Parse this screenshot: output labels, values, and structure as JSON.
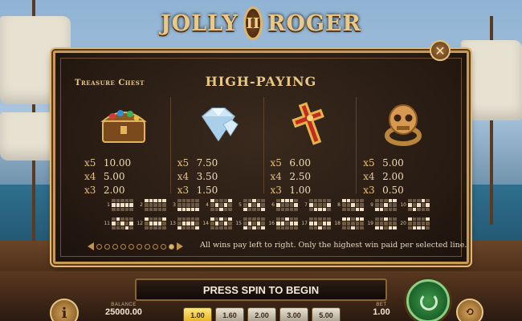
{
  "logo": {
    "left": "JOLLY",
    "emblem": "II",
    "right": "ROGER"
  },
  "panel": {
    "corner_label": "Treasure Chest",
    "title": "HIGH-PAYING",
    "close_icon": "✕",
    "symbols": [
      {
        "icon": "treasure-chest-icon",
        "payouts": [
          [
            "x5",
            "10.00"
          ],
          [
            "x4",
            "5.00"
          ],
          [
            "x3",
            "2.00"
          ]
        ]
      },
      {
        "icon": "diamond-icon",
        "payouts": [
          [
            "x5",
            "7.50"
          ],
          [
            "x4",
            "3.50"
          ],
          [
            "x3",
            "1.50"
          ]
        ]
      },
      {
        "icon": "ruby-cross-icon",
        "payouts": [
          [
            "x5",
            "6.00"
          ],
          [
            "x4",
            "2.50"
          ],
          [
            "x3",
            "1.00"
          ]
        ]
      },
      {
        "icon": "skull-ring-icon",
        "payouts": [
          [
            "x5",
            "5.00"
          ],
          [
            "x4",
            "2.00"
          ],
          [
            "x3",
            "0.50"
          ]
        ]
      }
    ],
    "paylines": {
      "row1": [
        "1",
        "2",
        "3",
        "4",
        "5",
        "6",
        "7",
        "8",
        "9",
        "10"
      ],
      "row2": [
        "11",
        "12",
        "13",
        "14",
        "15",
        "16",
        "17",
        "18",
        "19",
        "20"
      ]
    },
    "pager": {
      "total": 10,
      "active_index": 9
    },
    "rules_note": "All wins pay left to right. Only the highest win paid per selected line."
  },
  "bottom": {
    "message": "PRESS SPIN TO BEGIN",
    "balance_label": "BALANCE",
    "balance_value": "25000.00",
    "bet_options": [
      "1.00",
      "1.60",
      "2.00",
      "3.00",
      "5.00"
    ],
    "selected_bet_index": 0,
    "bet_label": "BET",
    "bet_value": "1.00",
    "info_icon": "i"
  }
}
